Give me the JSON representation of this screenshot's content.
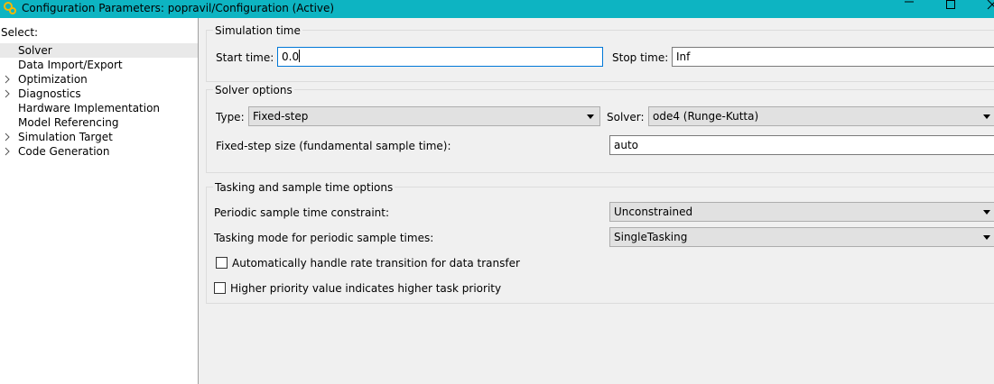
{
  "window": {
    "title": "Configuration Parameters: popravil/Configuration (Active)",
    "controls": {
      "minimize": "minimize-icon",
      "maximize": "maximize-icon",
      "close": "close-icon"
    }
  },
  "tree": {
    "select_label": "Select:",
    "items": [
      {
        "label": "Solver",
        "expandable": false,
        "selected": true
      },
      {
        "label": "Data Import/Export",
        "expandable": false,
        "selected": false
      },
      {
        "label": "Optimization",
        "expandable": true,
        "selected": false
      },
      {
        "label": "Diagnostics",
        "expandable": true,
        "selected": false
      },
      {
        "label": "Hardware Implementation",
        "expandable": false,
        "selected": false
      },
      {
        "label": "Model Referencing",
        "expandable": false,
        "selected": false
      },
      {
        "label": "Simulation Target",
        "expandable": true,
        "selected": false
      },
      {
        "label": "Code Generation",
        "expandable": true,
        "selected": false
      }
    ]
  },
  "simulation_time": {
    "title": "Simulation time",
    "start_label": "Start time:",
    "start_value": "0.0",
    "stop_label": "Stop time:",
    "stop_value": "Inf"
  },
  "solver_options": {
    "title": "Solver options",
    "type_label": "Type:",
    "type_value": "Fixed-step",
    "solver_label": "Solver:",
    "solver_value": "ode4 (Runge-Kutta)",
    "step_label": "Fixed-step size (fundamental sample time):",
    "step_value": "auto"
  },
  "tasking": {
    "title": "Tasking and sample time options",
    "periodic_label": "Periodic sample time constraint:",
    "periodic_value": "Unconstrained",
    "mode_label": "Tasking mode for periodic sample times:",
    "mode_value": "SingleTasking",
    "rate_transition_label": "Automatically handle rate transition for data transfer",
    "rate_transition_checked": false,
    "priority_label": "Higher priority value indicates higher task priority",
    "priority_checked": false
  },
  "colors": {
    "titlebar": "#0db4c2",
    "focus": "#0078d7",
    "selected_row": "#e9e9e9"
  }
}
